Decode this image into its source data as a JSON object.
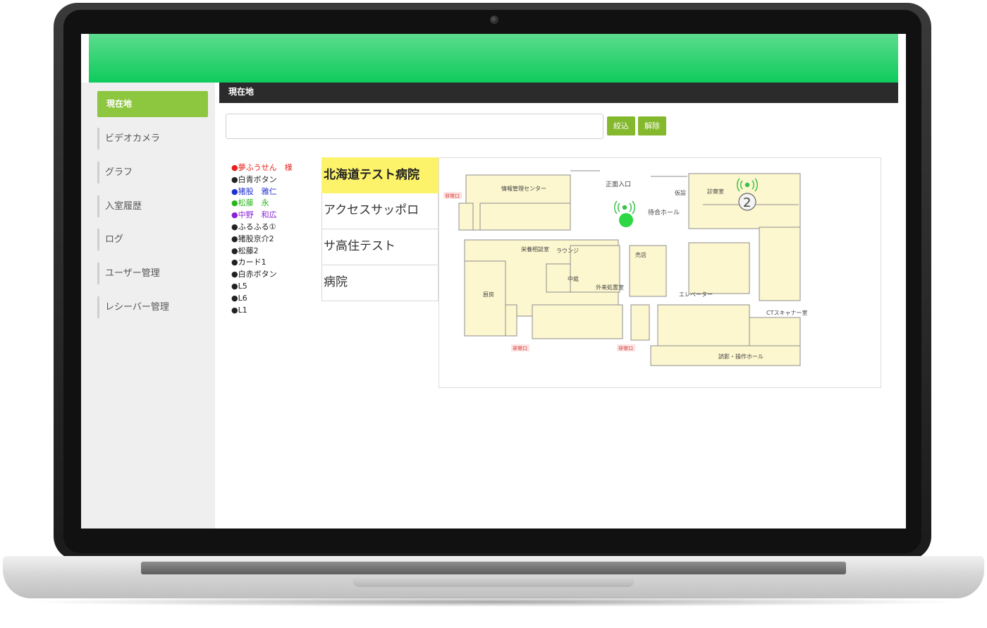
{
  "sidebar": {
    "items": [
      {
        "label": "現在地",
        "active": true
      },
      {
        "label": "ビデオカメラ"
      },
      {
        "label": "グラフ"
      },
      {
        "label": "入室履歴"
      },
      {
        "label": "ログ"
      },
      {
        "label": "ユーザー管理"
      },
      {
        "label": "レシーバー管理"
      }
    ]
  },
  "header": {
    "title": "現在地"
  },
  "search": {
    "value": "",
    "filter_label": "絞込",
    "clear_label": "解除"
  },
  "legend": {
    "items": [
      {
        "label": "●夢ふうせん　様",
        "color": "#e8201b"
      },
      {
        "label": "●白青ボタン",
        "color": "#222222"
      },
      {
        "label": "●猪股　雅仁",
        "color": "#1f2fd0"
      },
      {
        "label": "●松藤　永",
        "color": "#28b61a"
      },
      {
        "label": "●中野　和広",
        "color": "#8a1fd6"
      },
      {
        "label": "●ふるふる①",
        "color": "#222222"
      },
      {
        "label": "●猪股京介2",
        "color": "#222222"
      },
      {
        "label": "●松藤2",
        "color": "#222222"
      },
      {
        "label": "●カード1",
        "color": "#222222"
      },
      {
        "label": "●白赤ボタン",
        "color": "#222222"
      },
      {
        "label": "●L5",
        "color": "#222222"
      },
      {
        "label": "●L6",
        "color": "#222222"
      },
      {
        "label": "●L1",
        "color": "#222222"
      }
    ]
  },
  "facility_tabs": [
    {
      "label": "北海道テスト病院",
      "active": true
    },
    {
      "label": "アクセスサッポロ"
    },
    {
      "label": "サ高住テスト"
    },
    {
      "label": "病院"
    }
  ],
  "map": {
    "labels": {
      "entrance": "正面入口",
      "waiting_hall": "待合ホール",
      "info_center": "情報管理センター",
      "consultation": "診察室",
      "cafeteria": "中庭",
      "lounge": "ラウンジ",
      "nutrition": "栄養相談室",
      "kitchen": "厨房",
      "shop": "売店",
      "elevator": "エレベーター",
      "emergency_exit": "非常口",
      "outpatient": "外来処置室",
      "exam_hall": "読影・操作ホール",
      "ct": "CTスキャナー室",
      "tower": "仮設"
    },
    "receiver_number": "2",
    "colors": {
      "floor": "#fdf7cf",
      "wall": "#8d8d8d",
      "person": "#2ed845",
      "signal": "#39c24a"
    }
  },
  "theme": {
    "topbar": "#18cf63",
    "accent": "#8dc63f",
    "header": "#2b2b2b",
    "tab_active": "#fdf36a"
  }
}
